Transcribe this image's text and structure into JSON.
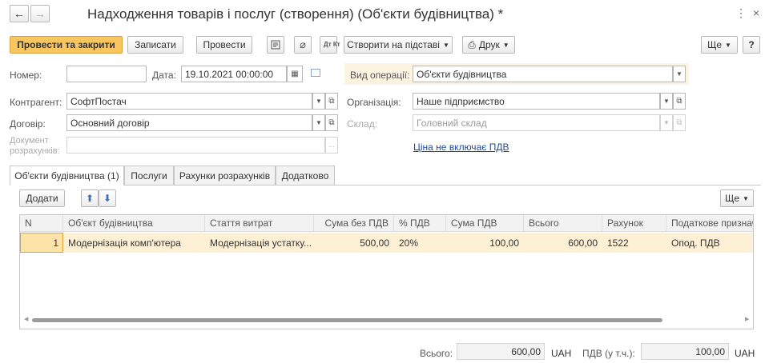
{
  "window": {
    "title": "Надходження товарів і послуг (створення) (Об'єкти будівництва) *"
  },
  "toolbar": {
    "post_and_close": "Провести та закрити",
    "save": "Записати",
    "post": "Провести",
    "dtkt": "Дт Кт",
    "create_based_on": "Створити на підставі",
    "print": "Друк",
    "more": "Ще",
    "help": "?"
  },
  "form": {
    "number": {
      "label": "Номер:",
      "value": ""
    },
    "date": {
      "label": "Дата:",
      "value": "19.10.2021 00:00:00"
    },
    "operation_kind": {
      "label": "Вид операції:",
      "value": "Об'єкти будівництва"
    },
    "counterparty": {
      "label": "Контрагент:",
      "value": "СофтПостач"
    },
    "organization": {
      "label": "Організація:",
      "value": "Наше підприємство"
    },
    "contract": {
      "label": "Договір:",
      "value": "Основний договір"
    },
    "warehouse": {
      "label": "Склад:",
      "value": "Головний склад"
    },
    "settlement_doc": {
      "label_line1": "Документ",
      "label_line2": "розрахунків:",
      "value": "",
      "btn": "..."
    },
    "vat_link": "Ціна не включає ПДВ"
  },
  "tabs": [
    {
      "label": "Об'єкти будівництва (1)",
      "active": true
    },
    {
      "label": "Послуги",
      "active": false
    },
    {
      "label": "Рахунки розрахунків",
      "active": false
    },
    {
      "label": "Додатково",
      "active": false
    }
  ],
  "table_toolbar": {
    "add": "Додати",
    "more": "Ще"
  },
  "table": {
    "columns": [
      "N",
      "Об'єкт будівництва",
      "Стаття витрат",
      "Сума без ПДВ",
      "% ПДВ",
      "Сума ПДВ",
      "Всього",
      "Рахунок",
      "Податкове призначення"
    ],
    "rows": [
      [
        "1",
        "Модернізація комп'ютера",
        "Модернізація устатку...",
        "500,00",
        "20%",
        "100,00",
        "600,00",
        "1522",
        "Опод. ПДВ"
      ]
    ]
  },
  "totals": {
    "total_label": "Всього:",
    "total_value": "600,00",
    "currency": "UAH",
    "vat_label": "ПДВ (у т.ч.):",
    "vat_value": "100,00",
    "vat_currency": "UAH"
  },
  "colors": {
    "accent": "#f8c55f",
    "row_selected": "#fdf0d5",
    "link": "#1e4c9a",
    "highlight_bg": "#fdf3e1"
  }
}
